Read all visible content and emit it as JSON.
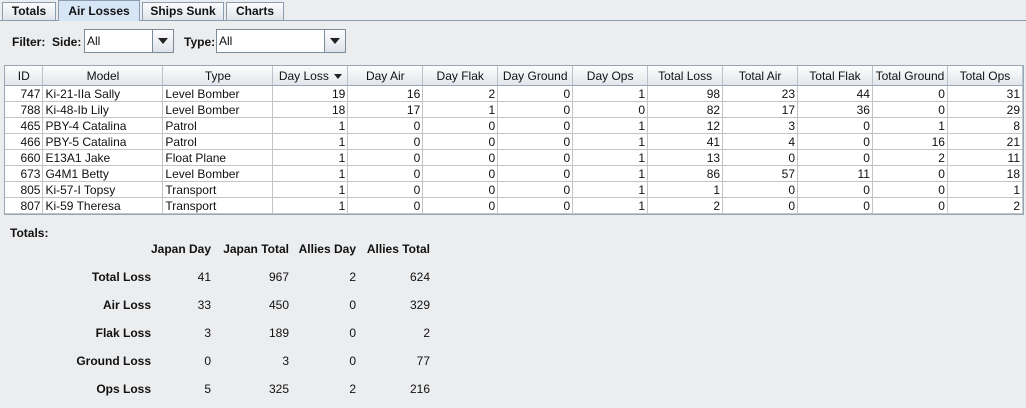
{
  "tabs": [
    {
      "label": "Totals",
      "active": false
    },
    {
      "label": "Air Losses",
      "active": true
    },
    {
      "label": "Ships Sunk",
      "active": false
    },
    {
      "label": "Charts",
      "active": false
    }
  ],
  "filter": {
    "label": "Filter:",
    "side_label": "Side:",
    "side_value": "All",
    "type_label": "Type:",
    "type_value": "All"
  },
  "table": {
    "columns": [
      "ID",
      "Model",
      "Type",
      "Day Loss",
      "Day Air",
      "Day Flak",
      "Day Ground",
      "Day Ops",
      "Total Loss",
      "Total Air",
      "Total Flak",
      "Total Ground",
      "Total Ops"
    ],
    "sorted_column": "Day Loss",
    "rows": [
      [
        "747",
        "Ki-21-IIa Sally",
        "Level Bomber",
        "19",
        "16",
        "2",
        "0",
        "1",
        "98",
        "23",
        "44",
        "0",
        "31"
      ],
      [
        "788",
        "Ki-48-Ib Lily",
        "Level Bomber",
        "18",
        "17",
        "1",
        "0",
        "0",
        "82",
        "17",
        "36",
        "0",
        "29"
      ],
      [
        "465",
        "PBY-4 Catalina",
        "Patrol",
        "1",
        "0",
        "0",
        "0",
        "1",
        "12",
        "3",
        "0",
        "1",
        "8"
      ],
      [
        "466",
        "PBY-5 Catalina",
        "Patrol",
        "1",
        "0",
        "0",
        "0",
        "1",
        "41",
        "4",
        "0",
        "16",
        "21"
      ],
      [
        "660",
        "E13A1 Jake",
        "Float Plane",
        "1",
        "0",
        "0",
        "0",
        "1",
        "13",
        "0",
        "0",
        "2",
        "11"
      ],
      [
        "673",
        "G4M1 Betty",
        "Level Bomber",
        "1",
        "0",
        "0",
        "0",
        "1",
        "86",
        "57",
        "11",
        "0",
        "18"
      ],
      [
        "805",
        "Ki-57-I Topsy",
        "Transport",
        "1",
        "0",
        "0",
        "0",
        "1",
        "1",
        "0",
        "0",
        "0",
        "1"
      ],
      [
        "807",
        "Ki-59 Theresa",
        "Transport",
        "1",
        "0",
        "0",
        "0",
        "1",
        "2",
        "0",
        "0",
        "0",
        "2"
      ]
    ]
  },
  "totals": {
    "label": "Totals:",
    "headers": [
      "Japan Day",
      "Japan Total",
      "Allies Day",
      "Allies Total"
    ],
    "rows": [
      {
        "label": "Total Loss",
        "values": [
          "41",
          "967",
          "2",
          "624"
        ]
      },
      {
        "label": "Air Loss",
        "values": [
          "33",
          "450",
          "0",
          "329"
        ]
      },
      {
        "label": "Flak Loss",
        "values": [
          "3",
          "189",
          "0",
          "2"
        ]
      },
      {
        "label": "Ground Loss",
        "values": [
          "0",
          "3",
          "0",
          "77"
        ]
      },
      {
        "label": "Ops Loss",
        "values": [
          "5",
          "325",
          "2",
          "216"
        ]
      }
    ]
  },
  "icons": {
    "dropdown": "chevron-down-icon",
    "sort": "sort-descending-icon"
  },
  "colors": {
    "active_tab": "#d7e6f6",
    "background": "#ecedef",
    "grid_line": "#c4c4c4"
  }
}
